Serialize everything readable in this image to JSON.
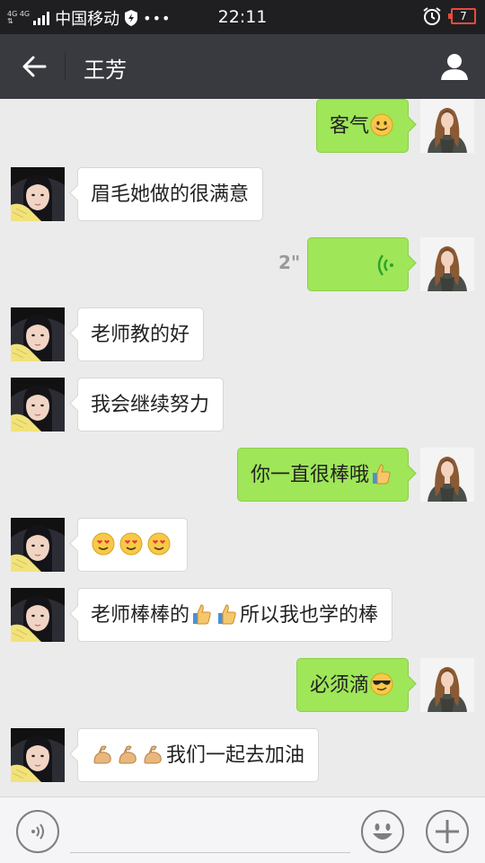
{
  "status_bar": {
    "network_top": "4G 4G",
    "network_bottom": "⇅",
    "carrier": "中国移动",
    "dots": "•••",
    "time": "22:11",
    "battery": "7",
    "icons": [
      "signal-icon",
      "shield-icon",
      "alarm-clock-icon",
      "battery-icon"
    ]
  },
  "header": {
    "title": "王芳",
    "back_icon": "arrow-left-icon",
    "profile_icon": "person-icon"
  },
  "messages": [
    {
      "side": "out",
      "text": "客气",
      "emoji": [
        "smile"
      ]
    },
    {
      "side": "in",
      "text": "眉毛她做的很满意",
      "emoji": []
    },
    {
      "side": "out",
      "type": "voice",
      "duration": "2\""
    },
    {
      "side": "in",
      "text": "老师教的好",
      "emoji": []
    },
    {
      "side": "in",
      "text": "我会继续努力",
      "emoji": []
    },
    {
      "side": "out",
      "text": "你一直很棒哦",
      "emoji": [
        "thumbs-up"
      ]
    },
    {
      "side": "in",
      "text": "",
      "emoji": [
        "heart-eyes",
        "heart-eyes",
        "heart-eyes"
      ]
    },
    {
      "side": "in",
      "text": "所以我也学的棒",
      "prefix": "老师棒棒的",
      "emoji": [
        "thumbs-up",
        "thumbs-up"
      ]
    },
    {
      "side": "out",
      "text": "必须滴",
      "emoji": [
        "cool"
      ]
    },
    {
      "side": "in",
      "text": "我们一起去加油",
      "emoji": [
        "muscle",
        "muscle",
        "muscle"
      ]
    }
  ],
  "input_bar": {
    "placeholder": "",
    "voice_icon": "voice-icon",
    "emoji_icon": "emoji-icon",
    "plus_icon": "plus-icon"
  },
  "colors": {
    "title_bar": "#393a3f",
    "background": "#ebebeb",
    "outgoing_bubble": "#9fe658",
    "incoming_bubble": "#ffffff"
  }
}
